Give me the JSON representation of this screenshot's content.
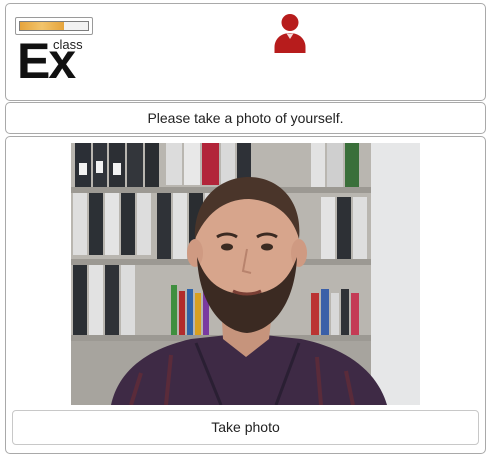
{
  "header": {
    "logo": {
      "main_text": "Ex",
      "sub_text": "class",
      "bar_fill_percent": 65,
      "bar_color": "#e6a43c"
    },
    "user_icon": {
      "icon": "user-icon",
      "color": "#b71c1c"
    }
  },
  "prompt": {
    "text": "Please take a photo of yourself."
  },
  "camera": {
    "view": "webcam-feed"
  },
  "actions": {
    "take_photo_label": "Take photo"
  }
}
